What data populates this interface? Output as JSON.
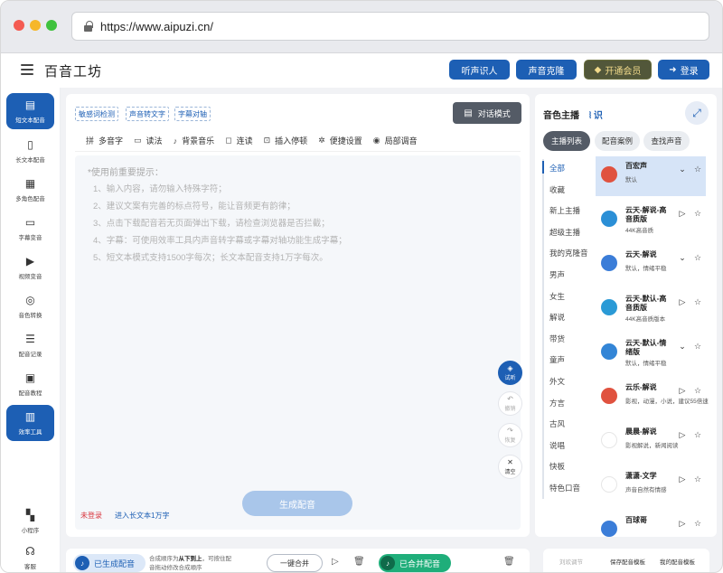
{
  "browser": {
    "url": "https://www.aipuzi.cn/"
  },
  "header": {
    "brand": "百音工坊",
    "buttons": [
      {
        "label": "听声识人",
        "icon": ""
      },
      {
        "label": "声音克隆",
        "icon": ""
      },
      {
        "label": "开通会员",
        "icon": "diamond-icon"
      },
      {
        "label": "登录",
        "icon": "login-icon"
      }
    ]
  },
  "sidebar": {
    "items": [
      {
        "label": "短文本配音",
        "icon": "document-icon",
        "active": true
      },
      {
        "label": "长文本配音",
        "icon": "long-text-icon",
        "active": false
      },
      {
        "label": "多角色配音",
        "icon": "multi-role-icon",
        "active": false
      },
      {
        "label": "字幕变音",
        "icon": "subtitle-icon",
        "active": false
      },
      {
        "label": "视频变音",
        "icon": "video-icon",
        "active": false
      },
      {
        "label": "音色转换",
        "icon": "voice-convert-icon",
        "active": false
      },
      {
        "label": "配音记录",
        "icon": "record-icon",
        "active": false
      },
      {
        "label": "配音教程",
        "icon": "tutorial-icon",
        "active": false
      },
      {
        "label": "效率工具",
        "icon": "toolbox-icon",
        "active": true
      }
    ],
    "bottom": [
      {
        "label": "小程序",
        "icon": "grid-icon"
      },
      {
        "label": "客服",
        "icon": "headset-icon"
      }
    ]
  },
  "editor": {
    "tags": [
      "敏感词检测",
      "声音转文字",
      "字幕对轴"
    ],
    "dialog_mode": "对话模式",
    "tools": [
      {
        "label": "多音字",
        "icon": "pinyin-icon"
      },
      {
        "label": "读法",
        "icon": "read-icon"
      },
      {
        "label": "背景音乐",
        "icon": "music-icon"
      },
      {
        "label": "连读",
        "icon": "link-read-icon"
      },
      {
        "label": "插入停顿",
        "icon": "pause-icon"
      },
      {
        "label": "便捷设置",
        "icon": "settings-icon"
      },
      {
        "label": "局部调音",
        "icon": "tune-icon"
      }
    ],
    "hint_title": "*使用前重要提示：",
    "hints": [
      "1、输入内容，请勿输入特殊字符；",
      "2、建议文案有完善的标点符号，能让音频更有韵律；",
      "3、点击下载配音若无页面弹出下载，请检查浏览器是否拦截；",
      "4、字幕：可使用效率工具内声音转字幕或字幕对轴功能生成字幕；",
      "5、短文本模式支持1500字每次；长文本配音支持1万字每次。"
    ],
    "fabs": [
      {
        "label": "试听",
        "icon": "listen-icon"
      },
      {
        "label": "撤销",
        "icon": "undo-icon"
      },
      {
        "label": "恢复",
        "icon": "redo-icon"
      },
      {
        "label": "清空",
        "icon": "close-icon"
      }
    ],
    "generate": "生成配音",
    "login_state": "未登录",
    "long_text_link": "进入长文本1万字"
  },
  "voice_panel": {
    "title": "音色主播",
    "recognize": "识",
    "tabs": [
      "主播列表",
      "配音案例",
      "查找声音"
    ],
    "categories": [
      "全部",
      "收藏",
      "新上主播",
      "超级主播",
      "我的克隆音",
      "男声",
      "女生",
      "解说",
      "带货",
      "童声",
      "外文",
      "方言",
      "古风",
      "说唱",
      "快板",
      "特色口音"
    ],
    "voices": [
      {
        "name": "百宏声",
        "desc": "默认",
        "avatar_color": "#e0523f",
        "active": true
      },
      {
        "name": "云天-解说-高音质版",
        "desc": "44K高音质",
        "avatar_color": "#2b8fd6",
        "active": false
      },
      {
        "name": "云天-解说",
        "desc": "默认，情绪平稳",
        "avatar_color": "#3b7dd8",
        "active": false
      },
      {
        "name": "云天-默认-高音质版",
        "desc": "44K高音质版本",
        "avatar_color": "#2a9ad6",
        "active": false
      },
      {
        "name": "云天-默认-情绪版",
        "desc": "默认，情绪平稳",
        "avatar_color": "#3385d6",
        "active": false
      },
      {
        "name": "云乐-解说",
        "desc": "影视，动漫，小说，建议55倍速",
        "avatar_color": "#e0523f",
        "active": false
      },
      {
        "name": "晨晨-解说",
        "desc": "影视解说，新闻阅读",
        "avatar_color": "#ffffff",
        "active": false
      },
      {
        "name": "潇潇-文学",
        "desc": "声音自然有情感",
        "avatar_color": "#ffffff",
        "active": false
      },
      {
        "name": "百球哥",
        "desc": "",
        "avatar_color": "#3b7dd8",
        "active": false
      }
    ],
    "footer": [
      "刘欢调节",
      "保存配音模板",
      "我的配音模板"
    ]
  },
  "bottom": {
    "generated": "已生成配音",
    "order_line1_prefix": "合成顺序为",
    "order_strong": "从下到上",
    "order_line1_suffix": "，可按住配",
    "order_line2": "音拖动修改合成顺序",
    "merge": "一键合并",
    "merged": "已合并配音"
  }
}
